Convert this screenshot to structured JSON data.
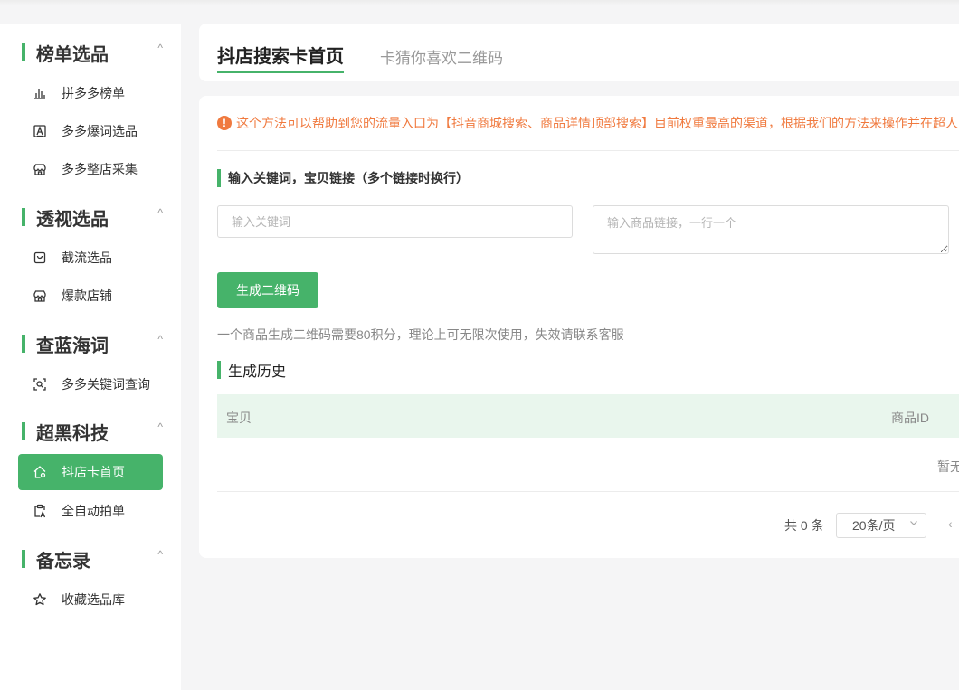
{
  "sidebar": {
    "groups": [
      {
        "title": "榜单选品",
        "items": [
          {
            "label": "拼多多榜单",
            "icon": "bar-chart-icon"
          },
          {
            "label": "多多爆词选品",
            "icon": "letter-a-box-icon"
          },
          {
            "label": "多多整店采集",
            "icon": "store-icon"
          }
        ]
      },
      {
        "title": "透视选品",
        "items": [
          {
            "label": "截流选品",
            "icon": "bag-icon"
          },
          {
            "label": "爆款店铺",
            "icon": "store-icon"
          }
        ]
      },
      {
        "title": "查蓝海词",
        "items": [
          {
            "label": "多多关键词查询",
            "icon": "scan-search-icon"
          }
        ]
      },
      {
        "title": "超黑科技",
        "items": [
          {
            "label": "抖店卡首页",
            "icon": "home-settings-icon"
          },
          {
            "label": "全自动拍单",
            "icon": "clipboard-a-icon"
          }
        ]
      },
      {
        "title": "备忘录",
        "items": [
          {
            "label": "收藏选品库",
            "icon": "star-icon"
          }
        ]
      }
    ],
    "caret": "^"
  },
  "tabs": {
    "active": "抖店搜索卡首页",
    "inactive": "卡猜你喜欢二维码"
  },
  "notice": {
    "icon": "!",
    "text": "这个方法可以帮助到您的流量入口为【抖音商城搜索、商品详情顶部搜索】目前权重最高的渠道，根据我们的方法来操作并在超人"
  },
  "form": {
    "section_title": "输入关键词，宝贝链接（多个链接时换行）",
    "keyword_placeholder": "输入关键词",
    "links_placeholder": "输入商品链接，一行一个",
    "generate_button": "生成二维码",
    "hint": "一个商品生成二维码需要80积分，理论上可无限次使用，失效请联系客服"
  },
  "history": {
    "title": "生成历史",
    "columns": [
      "宝贝",
      "商品ID"
    ],
    "empty_text": "暂无",
    "total": "共 0 条",
    "page_size": "20条/页",
    "prev": "‹"
  },
  "colors": {
    "accent": "#46b36a",
    "warning": "#f07a3f"
  }
}
